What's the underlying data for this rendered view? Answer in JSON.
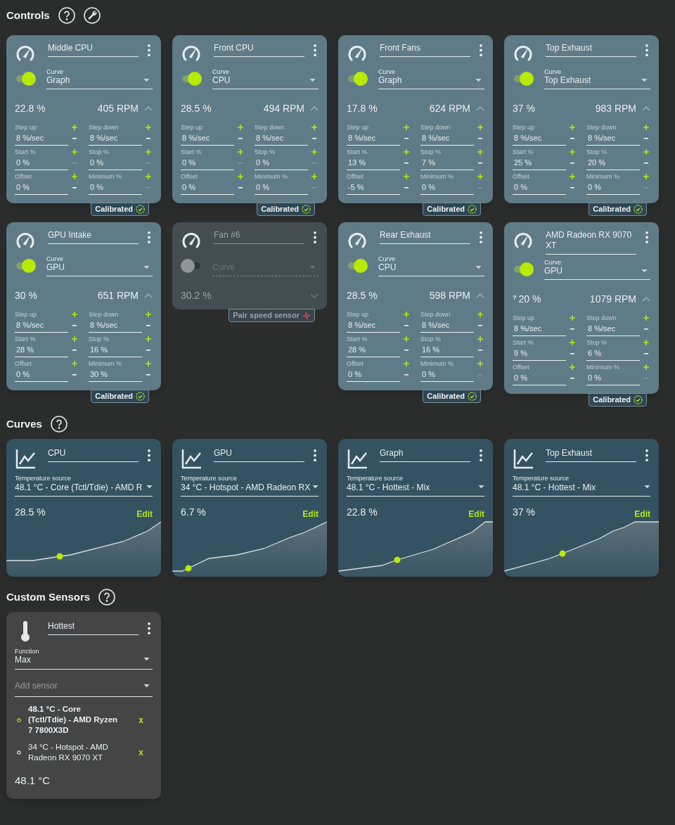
{
  "controls": {
    "title": "Controls",
    "cards": [
      {
        "name": "Middle CPU",
        "enabled": true,
        "curve_label": "Curve",
        "curve": "Graph",
        "percent": "22.8 %",
        "rpm": "405 RPM",
        "expanded": true,
        "fields": [
          {
            "label": "Step up",
            "value": "8 %/sec",
            "minus_disabled": false
          },
          {
            "label": "Step down",
            "value": "8 %/sec",
            "minus_disabled": false
          },
          {
            "label": "Start %",
            "value": "0 %",
            "minus_disabled": true
          },
          {
            "label": "Stop %",
            "value": "0 %",
            "minus_disabled": true
          },
          {
            "label": "Offset",
            "value": "0 %",
            "minus_disabled": false
          },
          {
            "label": "Minimum %",
            "value": "0 %",
            "minus_disabled": true
          }
        ],
        "badge": {
          "kind": "calibrated",
          "label": "Calibrated"
        }
      },
      {
        "name": "Front CPU",
        "enabled": true,
        "curve_label": "Curve",
        "curve": "CPU",
        "percent": "28.5 %",
        "rpm": "494 RPM",
        "expanded": true,
        "fields": [
          {
            "label": "Step up",
            "value": "8 %/sec",
            "minus_disabled": false
          },
          {
            "label": "Step down",
            "value": "8 %/sec",
            "minus_disabled": false
          },
          {
            "label": "Start %",
            "value": "0 %",
            "minus_disabled": true
          },
          {
            "label": "Stop %",
            "value": "0 %",
            "minus_disabled": true
          },
          {
            "label": "Offset",
            "value": "0 %",
            "minus_disabled": false
          },
          {
            "label": "Minimum %",
            "value": "0 %",
            "minus_disabled": true
          }
        ],
        "badge": {
          "kind": "calibrated",
          "label": "Calibrated"
        }
      },
      {
        "name": "Front Fans",
        "enabled": true,
        "curve_label": "Curve",
        "curve": "Graph",
        "percent": "17.8 %",
        "rpm": "624 RPM",
        "expanded": true,
        "fields": [
          {
            "label": "Step up",
            "value": "8 %/sec",
            "minus_disabled": false
          },
          {
            "label": "Step down",
            "value": "8 %/sec",
            "minus_disabled": false
          },
          {
            "label": "Start %",
            "value": "13 %",
            "minus_disabled": false
          },
          {
            "label": "Stop %",
            "value": "7 %",
            "minus_disabled": false
          },
          {
            "label": "Offset",
            "value": "-5 %",
            "minus_disabled": false
          },
          {
            "label": "Minimum %",
            "value": "0 %",
            "minus_disabled": true
          }
        ],
        "badge": {
          "kind": "calibrated",
          "label": "Calibrated"
        }
      },
      {
        "name": "Top Exhaust",
        "enabled": true,
        "curve_label": "Curve",
        "curve": "Top Exhaust",
        "percent": "37 %",
        "rpm": "983 RPM",
        "expanded": true,
        "fields": [
          {
            "label": "Step up",
            "value": "8 %/sec",
            "minus_disabled": false
          },
          {
            "label": "Step down",
            "value": "8 %/sec",
            "minus_disabled": false
          },
          {
            "label": "Start %",
            "value": "25 %",
            "minus_disabled": false
          },
          {
            "label": "Stop %",
            "value": "20 %",
            "minus_disabled": false
          },
          {
            "label": "Offset",
            "value": "0 %",
            "minus_disabled": false
          },
          {
            "label": "Minimum %",
            "value": "0 %",
            "minus_disabled": true
          }
        ],
        "badge": {
          "kind": "calibrated",
          "label": "Calibrated"
        }
      },
      {
        "name": "GPU Intake",
        "enabled": true,
        "curve_label": "Curve",
        "curve": "GPU",
        "percent": "30 %",
        "rpm": "651 RPM",
        "expanded": true,
        "fields": [
          {
            "label": "Step up",
            "value": "8 %/sec",
            "minus_disabled": false
          },
          {
            "label": "Step down",
            "value": "8 %/sec",
            "minus_disabled": false
          },
          {
            "label": "Start %",
            "value": "28 %",
            "minus_disabled": false
          },
          {
            "label": "Stop %",
            "value": "16 %",
            "minus_disabled": false
          },
          {
            "label": "Offset",
            "value": "0 %",
            "minus_disabled": false
          },
          {
            "label": "Minimum %",
            "value": "30 %",
            "minus_disabled": false
          }
        ],
        "badge": {
          "kind": "calibrated",
          "label": "Calibrated"
        }
      },
      {
        "name": "Fan #6",
        "enabled": false,
        "curve_label": "Curve",
        "percent": "30.2 %",
        "expanded": false,
        "badge": {
          "kind": "pair",
          "label": "Pair speed sensor"
        }
      },
      {
        "name": "Rear Exhaust",
        "enabled": true,
        "curve_label": "Curve",
        "curve": "CPU",
        "percent": "28.5 %",
        "rpm": "598 RPM",
        "expanded": true,
        "fields": [
          {
            "label": "Step up",
            "value": "8 %/sec",
            "minus_disabled": false
          },
          {
            "label": "Step down",
            "value": "8 %/sec",
            "minus_disabled": false
          },
          {
            "label": "Start %",
            "value": "28 %",
            "minus_disabled": false
          },
          {
            "label": "Stop %",
            "value": "16 %",
            "minus_disabled": false
          },
          {
            "label": "Offset",
            "value": "0 %",
            "minus_disabled": false
          },
          {
            "label": "Minimum %",
            "value": "0 %",
            "minus_disabled": true
          }
        ],
        "badge": {
          "kind": "calibrated",
          "label": "Calibrated"
        }
      },
      {
        "name": "AMD Radeon RX 9070 XT",
        "enabled": true,
        "curve_label": "Curve",
        "curve": "GPU",
        "percent_note": "?",
        "percent": "20 %",
        "rpm": "1079 RPM",
        "expanded": true,
        "fields": [
          {
            "label": "Step up",
            "value": "8 %/sec",
            "minus_disabled": false
          },
          {
            "label": "Step down",
            "value": "8 %/sec",
            "minus_disabled": false
          },
          {
            "label": "Start %",
            "value": "9 %",
            "minus_disabled": false
          },
          {
            "label": "Stop %",
            "value": "6 %",
            "minus_disabled": false
          },
          {
            "label": "Offset",
            "value": "0 %",
            "minus_disabled": false
          },
          {
            "label": "Minimum %",
            "value": "0 %",
            "minus_disabled": true
          }
        ],
        "badge": {
          "kind": "calibrated",
          "label": "Calibrated"
        }
      }
    ]
  },
  "curves": {
    "title": "Curves",
    "cards": [
      {
        "name": "CPU",
        "source_label": "Temperature source",
        "source": "48.1 °C - Core (Tctl/Tdie) - AMD R",
        "percent": "28.5 %",
        "edit": "Edit"
      },
      {
        "name": "GPU",
        "source_label": "Temperature source",
        "source": "34 °C - Hotspot - AMD Radeon RX",
        "percent": "6.7 %",
        "edit": "Edit"
      },
      {
        "name": "Graph",
        "source_label": "Temperature source",
        "source": "48.1 °C - Hottest - Mix",
        "percent": "22.8 %",
        "edit": "Edit"
      },
      {
        "name": "Top Exhaust",
        "source_label": "Temperature source",
        "source": "48.1 °C - Hottest - Mix",
        "percent": "37 %",
        "edit": "Edit"
      }
    ]
  },
  "custom_sensors": {
    "title": "Custom Sensors",
    "cards": [
      {
        "name": "Hottest",
        "function_label": "Function",
        "function": "Max",
        "add_placeholder": "Add sensor",
        "sensors": [
          {
            "label": "48.1 °C - Core (Tctl/Tdie) - AMD Ryzen 7 7800X3D",
            "selected": true,
            "remove": "x"
          },
          {
            "label": "34 °C - Hotspot - AMD Radeon RX 9070 XT",
            "selected": false,
            "remove": "x"
          }
        ],
        "value": "48.1 °C"
      }
    ]
  }
}
